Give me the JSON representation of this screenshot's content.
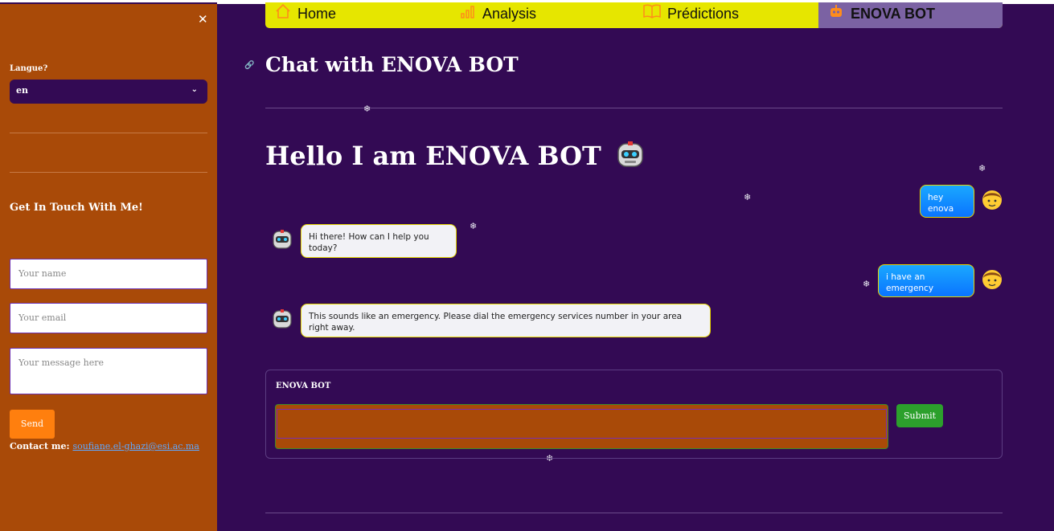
{
  "sidebar": {
    "close_icon": "close-icon",
    "language_label": "Langue?",
    "language_value": "en",
    "get_in_touch": "Get In Touch With Me!",
    "name_placeholder": "Your name",
    "email_placeholder": "Your email",
    "message_placeholder": "Your message here",
    "send_label": "Send",
    "contact_prefix": "Contact me:",
    "contact_email": "soufiane.el-ghazi@esi.ac.ma"
  },
  "nav": {
    "items": [
      {
        "label": "Home",
        "icon": "home-icon"
      },
      {
        "label": "Analysis",
        "icon": "bar-chart-icon"
      },
      {
        "label": "Prédictions",
        "icon": "book-icon"
      },
      {
        "label": "ENOVA BOT",
        "icon": "robot-icon",
        "active": true
      }
    ],
    "active_color": "#7b62a3",
    "bar_color": "#e6e600"
  },
  "main": {
    "title": "Chat with ENOVA BOT",
    "hello": "Hello I am ENOVA BOT",
    "messages": [
      {
        "role": "user",
        "text": "hey enova"
      },
      {
        "role": "bot",
        "text": "Hi there! How can I help you today?"
      },
      {
        "role": "user",
        "text": "i have an emergency"
      },
      {
        "role": "bot",
        "text": "This sounds like an emergency. Please dial the emergency services number in your area right away."
      }
    ],
    "input_label": "ENOVA BOT",
    "input_value": "",
    "submit_label": "Submit"
  },
  "colors": {
    "background": "#330a54",
    "sidebar": "#a94a08",
    "send_button": "#ff7f0e",
    "submit_button": "#2ca02c"
  }
}
